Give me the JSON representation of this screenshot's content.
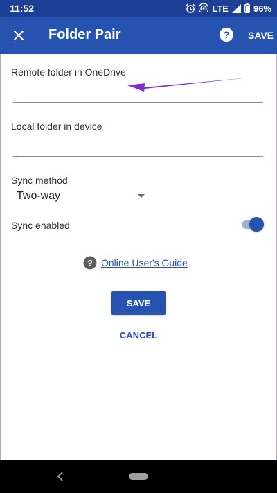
{
  "status_bar": {
    "time": "11:52",
    "network": "LTE",
    "battery": "96%",
    "icons": [
      "alarm-icon",
      "hotspot-icon",
      "signal-icon",
      "battery-icon"
    ]
  },
  "app_bar": {
    "title": "Folder Pair",
    "save_label": "SAVE",
    "close_icon": "close-icon",
    "help_icon": "help-icon"
  },
  "form": {
    "remote_label": "Remote folder in OneDrive",
    "remote_value": "",
    "local_label": "Local folder in device",
    "local_value": "",
    "sync_method_label": "Sync method",
    "sync_method_value": "Two-way",
    "sync_enabled_label": "Sync enabled",
    "sync_enabled": true
  },
  "guide": {
    "link_text": "Online User's Guide"
  },
  "buttons": {
    "save_label": "SAVE",
    "cancel_label": "CANCEL"
  },
  "colors": {
    "status_bar": "#1d3f96",
    "app_bar": "#2652b0",
    "accent": "#2652b0",
    "annotation_arrow": "#7b2fd0"
  }
}
